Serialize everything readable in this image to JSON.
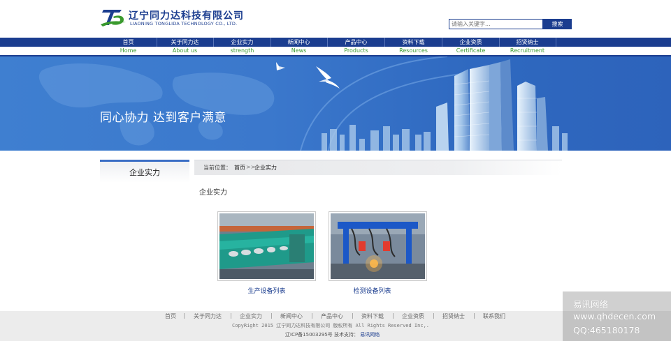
{
  "header": {
    "logo_cn": "辽宁同力达科技有限公司",
    "logo_en": "LIAONING TONGLIDA TECHNOLOGY CO., LTD.",
    "search_placeholder": "请输入关键字...",
    "search_button": "搜索"
  },
  "nav": {
    "items": [
      {
        "cn": "首页",
        "en": "Home"
      },
      {
        "cn": "关于同力达",
        "en": "About us"
      },
      {
        "cn": "企业实力",
        "en": "strength"
      },
      {
        "cn": "新闻中心",
        "en": "News"
      },
      {
        "cn": "产品中心",
        "en": "Products"
      },
      {
        "cn": "资料下载",
        "en": "Resources"
      },
      {
        "cn": "企业资质",
        "en": "Certificate"
      },
      {
        "cn": "招贤纳士",
        "en": "Recruitment"
      }
    ]
  },
  "banner": {
    "slogan": "同心协力 达到客户满意"
  },
  "sidebar": {
    "title": "企业实力"
  },
  "breadcrumb": {
    "label": "当前位置：",
    "home": "首页",
    "separator": ">>",
    "current": "企业实力"
  },
  "content": {
    "title": "企业实力",
    "items": [
      {
        "caption": "生产设备列表"
      },
      {
        "caption": "检测设备列表"
      }
    ]
  },
  "footer": {
    "links": [
      "首页",
      "关于同力达",
      "企业实力",
      "新闻中心",
      "产品中心",
      "资料下载",
      "企业资质",
      "招贤纳士",
      "联系我们"
    ],
    "copyright": "CopyRight 2015 辽宁同力达科技有限公司  版权所有 All Rights Reserved Inc,.",
    "icp": "辽ICP备15003295号",
    "tech_label": "技术支持：",
    "tech_name": "易讯网络"
  },
  "watermark": {
    "line1": "易讯网络",
    "line2": "www.qhdecen.com",
    "line3": "QQ:465180178"
  },
  "colors": {
    "brand_blue": "#1b3d8f",
    "nav_green": "#3a9a2e",
    "banner_blue": "#3b78cc"
  }
}
